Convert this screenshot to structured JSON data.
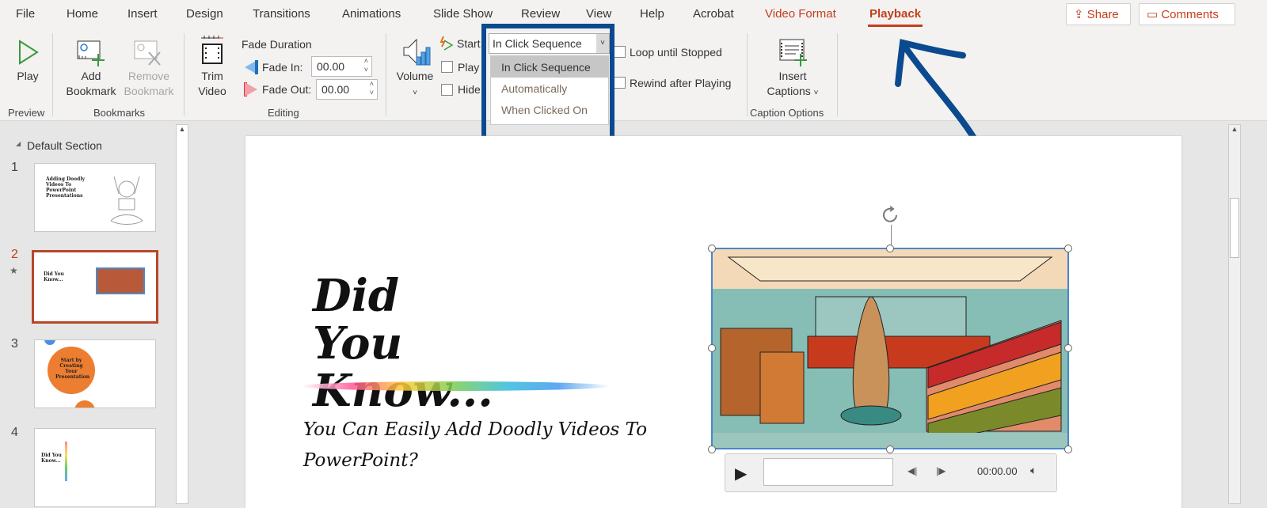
{
  "tabs": [
    "File",
    "Home",
    "Insert",
    "Design",
    "Transitions",
    "Animations",
    "Slide Show",
    "Review",
    "View",
    "Help",
    "Acrobat",
    "Video Format",
    "Playback"
  ],
  "share_label": "Share",
  "comments_label": "Comments",
  "ribbon": {
    "preview": {
      "play": "Play",
      "group": "Preview"
    },
    "bookmarks": {
      "add1": "Add",
      "add2": "Bookmark",
      "remove1": "Remove",
      "remove2": "Bookmark",
      "group": "Bookmarks"
    },
    "editing": {
      "trim1": "Trim",
      "trim2": "Video",
      "fade_duration": "Fade Duration",
      "fade_in_label": "Fade In:",
      "fade_in_value": "00.00",
      "fade_out_label": "Fade Out:",
      "fade_out_value": "00.00",
      "group": "Editing"
    },
    "video_options": {
      "volume": "Volume",
      "start_label": "Start:",
      "start_value": "In Click Sequence",
      "play_fullscreen": "Play",
      "hide": "Hide",
      "loop": "Loop until Stopped",
      "rewind": "Rewind after Playing"
    },
    "captions": {
      "insert1": "Insert",
      "insert2": "Captions",
      "group": "Caption Options"
    }
  },
  "start_options": [
    "In Click Sequence",
    "Automatically",
    "When Clicked On"
  ],
  "panel": {
    "section": "Default Section",
    "slides": [
      {
        "num": "1",
        "title": "Adding Doodly Videos To PowerPoint Presentations"
      },
      {
        "num": "2",
        "title": "Did You Know..."
      },
      {
        "num": "3",
        "title": "Start by Creating Your Presentation"
      },
      {
        "num": "4",
        "title": "Did You Know..."
      }
    ]
  },
  "slide": {
    "title": "Did You Know...",
    "subtitle": "You Can Easily Add Doodly Videos To PowerPoint?"
  },
  "player": {
    "time": "00:00.00"
  },
  "colors": {
    "accent": "#c43e1c",
    "highlight": "#0b4a8f"
  }
}
